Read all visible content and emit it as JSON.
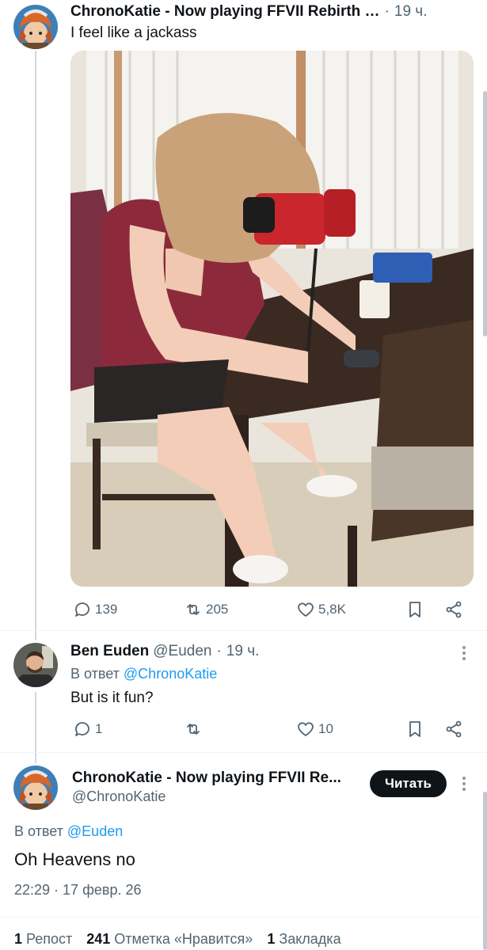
{
  "tweet": {
    "display_name": "ChronoKatie - Now playing FFVII Rebirth …",
    "time": "19 ч.",
    "text": "I feel like a jackass",
    "actions": {
      "replies": "139",
      "reposts": "205",
      "likes": "5,8K"
    }
  },
  "reply": {
    "display_name": "Ben Euden",
    "handle": "@Euden",
    "time": "19 ч.",
    "reply_prefix": "В ответ",
    "reply_mention": "@ChronoKatie",
    "text": "But is it fun?",
    "actions": {
      "replies": "1",
      "reposts": "",
      "likes": "10"
    }
  },
  "focus": {
    "display_name": "ChronoKatie - Now playing FFVII Re...",
    "handle": "@ChronoKatie",
    "follow_label": "Читать",
    "reply_prefix": "В ответ",
    "reply_mention": "@Euden",
    "text": "Oh Heavens no",
    "timestamp": "22:29 · 17 февр. 26",
    "stats": [
      {
        "count": "1",
        "label": "Репост"
      },
      {
        "count": "241",
        "label": "Отметка «Нравится»"
      },
      {
        "count": "1",
        "label": "Закладка"
      }
    ]
  },
  "colors": {
    "accent": "#1d9bf0",
    "text": "#0f1419",
    "muted": "#536471",
    "button": "#0f1419"
  },
  "icons": [
    "reply-icon",
    "repost-icon",
    "like-icon",
    "bookmark-icon",
    "share-icon",
    "more-icon"
  ]
}
